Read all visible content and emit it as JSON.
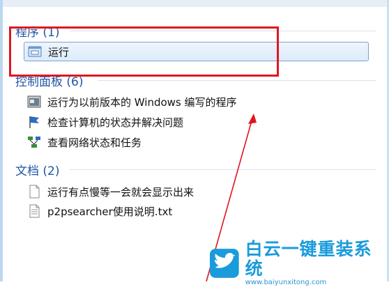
{
  "groups": {
    "programs": {
      "header": "程序 (1)",
      "items": [
        {
          "label": "运行",
          "icon": "run-icon"
        }
      ]
    },
    "control_panel": {
      "header": "控制面板 (6)",
      "items": [
        {
          "label": "运行为以前版本的 Windows 编写的程序",
          "icon": "compatibility-icon"
        },
        {
          "label": "检查计算机的状态并解决问题",
          "icon": "action-center-flag-icon"
        },
        {
          "label": "查看网络状态和任务",
          "icon": "network-icon"
        }
      ]
    },
    "documents": {
      "header": "文档 (2)",
      "items": [
        {
          "label": "运行有点慢等一会就会显示出来",
          "icon": "document-icon"
        },
        {
          "label": "p2psearcher使用说明.txt",
          "icon": "text-file-icon"
        }
      ]
    }
  },
  "watermark": {
    "title": "白云一键重装系统",
    "url": "www.baiyunxitong.com"
  },
  "colors": {
    "header_blue": "#1f56a6",
    "highlight_red": "#e0151f",
    "selection_border": "#7da2ce",
    "watermark_blue": "#1a9bdc"
  }
}
